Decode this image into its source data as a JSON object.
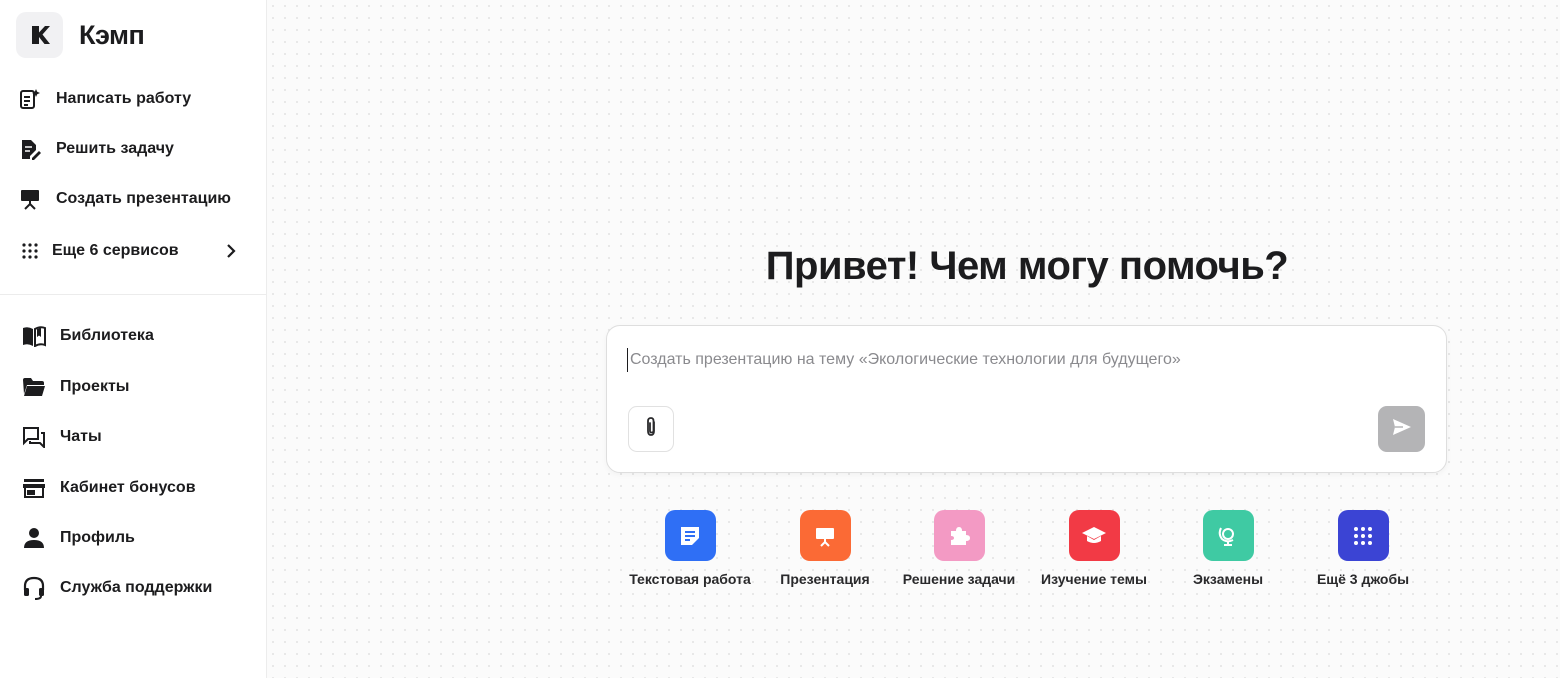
{
  "app": {
    "name": "Кэмп"
  },
  "sidebar": {
    "primary": [
      {
        "label": "Написать работу",
        "icon": "write-document-icon"
      },
      {
        "label": "Решить задачу",
        "icon": "edit-document-icon"
      },
      {
        "label": "Создать презентацию",
        "icon": "presentation-icon"
      },
      {
        "label": "Еще 6 сервисов",
        "icon": "grid-icon"
      }
    ],
    "secondary": [
      {
        "label": "Библиотека",
        "icon": "book-icon"
      },
      {
        "label": "Проекты",
        "icon": "folder-icon"
      },
      {
        "label": "Чаты",
        "icon": "chat-icon"
      },
      {
        "label": "Кабинет бонусов",
        "icon": "store-icon"
      },
      {
        "label": "Профиль",
        "icon": "person-icon"
      },
      {
        "label": "Служба поддержки",
        "icon": "headset-icon"
      }
    ]
  },
  "main": {
    "greeting": "Привет! Чем могу помочь?",
    "prompt": {
      "placeholder": "Создать презентацию на тему «Экологические технологии для будущего»",
      "value": ""
    },
    "quick_actions": [
      {
        "label": "Текстовая работа",
        "icon": "text-document-icon",
        "color": "#2f6ff5"
      },
      {
        "label": "Презентация",
        "icon": "presentation-icon",
        "color": "#fb6a35"
      },
      {
        "label": "Решение задачи",
        "icon": "puzzle-icon",
        "color": "#f39ac4"
      },
      {
        "label": "Изучение темы",
        "icon": "graduation-cap-icon",
        "color": "#f23a45"
      },
      {
        "label": "Экзамены",
        "icon": "globe-icon",
        "color": "#3fcaa3"
      },
      {
        "label": "Ещё 3 джобы",
        "icon": "grid-icon",
        "color": "#3b44d4"
      }
    ]
  }
}
